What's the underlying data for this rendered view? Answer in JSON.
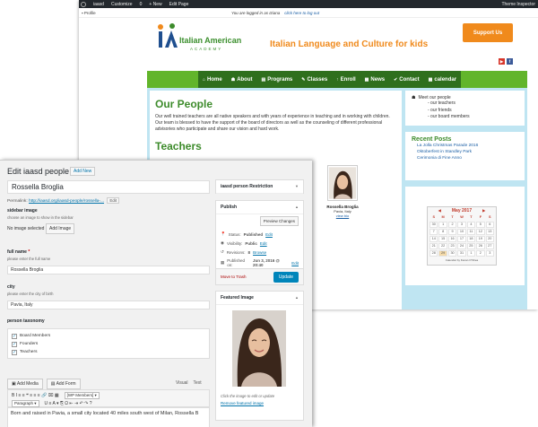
{
  "site": {
    "adminbar": {
      "items": [
        "iaasd",
        "Customize",
        "0",
        "+ New",
        "Edit Page"
      ],
      "right": "Theme Inspector"
    },
    "subbar": {
      "profile": "Profile",
      "logged_in": "You are logged in as Iziana",
      "logout": "click here to log out"
    },
    "logo": {
      "line1": "Italian American",
      "line2": "ACADEMY"
    },
    "tagline": "Italian Language and Culture for kids",
    "support_button": "Support Us",
    "social": {
      "youtube": "▶",
      "facebook": "f"
    },
    "nav": [
      {
        "icon": "⌂",
        "label": "Home"
      },
      {
        "icon": "☗",
        "label": "About"
      },
      {
        "icon": "▤",
        "label": "Programs"
      },
      {
        "icon": "✎",
        "label": "Classes"
      },
      {
        "icon": "↑",
        "label": "Enroll"
      },
      {
        "icon": "▦",
        "label": "News"
      },
      {
        "icon": "✔",
        "label": "Contact"
      },
      {
        "icon": "▦",
        "label": "calendar"
      }
    ],
    "main": {
      "heading": "Our People",
      "intro": "Our well trained teachers are all native speakers and with years of experience in teaching and in working with children. Our team is blessed to have the support of the board of directors as well as the counseling of different professional advisories who participate and share our vision and hard work.",
      "teachers_heading": "Teachers",
      "teacher": {
        "name": "Rossella Broglia",
        "city": "Pavia, Italy",
        "view": "view bio"
      }
    },
    "sidebar": {
      "menu_top": "Meet our people",
      "menu_items": [
        "- our teachers",
        "- our friends",
        "- our board members"
      ],
      "recent_heading": "Recent Posts",
      "recent_posts": [
        "La Jolla Christmas Parade 2016",
        "Oktoberfest in Standley Park",
        "Cerimonia di Fine Anno"
      ],
      "calendar": {
        "title": "May 2017",
        "days_of_week": [
          "S",
          "M",
          "T",
          "W",
          "T",
          "F",
          "S"
        ],
        "cells": [
          "30",
          "1",
          "2",
          "3",
          "4",
          "5",
          "6",
          "7",
          "8",
          "9",
          "10",
          "11",
          "12",
          "13",
          "14",
          "15",
          "16",
          "17",
          "18",
          "19",
          "20",
          "21",
          "22",
          "23",
          "24",
          "25",
          "26",
          "27",
          "28",
          "29",
          "30",
          "31",
          "1",
          "2",
          "3"
        ],
        "footer": "Calendar by Kieran O'Shea"
      }
    }
  },
  "admin": {
    "title": "Edit iaasd people",
    "add_new": "Add New",
    "post_title": "Rossella Broglia",
    "permalink_label": "Permalink:",
    "permalink_url": "http://iaasd.org/iaasd-people/rossella-...",
    "permalink_edit": "Edit",
    "sidebar_image": {
      "label": "sidebar image",
      "desc": "choose an image to show in the sidebar",
      "none": "No image selected",
      "button": "Add Image"
    },
    "full_name": {
      "label": "full name",
      "required": "*",
      "desc": "please enter the full name",
      "value": "Rossella Broglia"
    },
    "city": {
      "label": "city",
      "desc": "please enter the city of birth",
      "value": "Pavia, Italy"
    },
    "taxonomy": {
      "label": "person taxonomy",
      "items": [
        "Board Members",
        "Founders",
        "Teachers"
      ]
    },
    "media": {
      "add_media": "Add Media",
      "add_form": "Add Form",
      "tab_visual": "Visual",
      "tab_text": "Text"
    },
    "toolbar": {
      "row1": "B  I  ≡  ≡  ❝  ≡  ≡  ≡  🔗  ⌧  ▦",
      "row1_select": "[WP Members] ▾",
      "row2_select": "Paragraph ▾",
      "row2": "U  ≡  A  ▾  ⎘  Ω  ⇤  ⇥  ↶  ↷  ?"
    },
    "editor_text": "Born and raised in Pavia, a small city located 40 miles south west of Milan, Rossella B",
    "restriction_box": "iaasd person Restriction",
    "publish": {
      "heading": "Publish",
      "preview": "Preview Changes",
      "status_label": "Status:",
      "status_value": "Published",
      "status_edit": "Edit",
      "visibility_label": "Visibility:",
      "visibility_value": "Public",
      "visibility_edit": "Edit",
      "revisions_label": "Revisions:",
      "revisions_value": "8",
      "revisions_link": "Browse",
      "published_label": "Published on:",
      "published_value": "Jun 3, 2016 @ 20:40",
      "published_edit": "Edit",
      "trash": "Move to Trash",
      "update": "Update"
    },
    "featured": {
      "heading": "Featured Image",
      "caption": "Click the image to edit or update",
      "remove": "Remove featured image"
    }
  },
  "colors": {
    "green": "#3d8b2b",
    "nav_green": "#62b52b",
    "orange": "#f08a1c",
    "wp_blue": "#0085ba",
    "sky": "#bfe5f2"
  }
}
